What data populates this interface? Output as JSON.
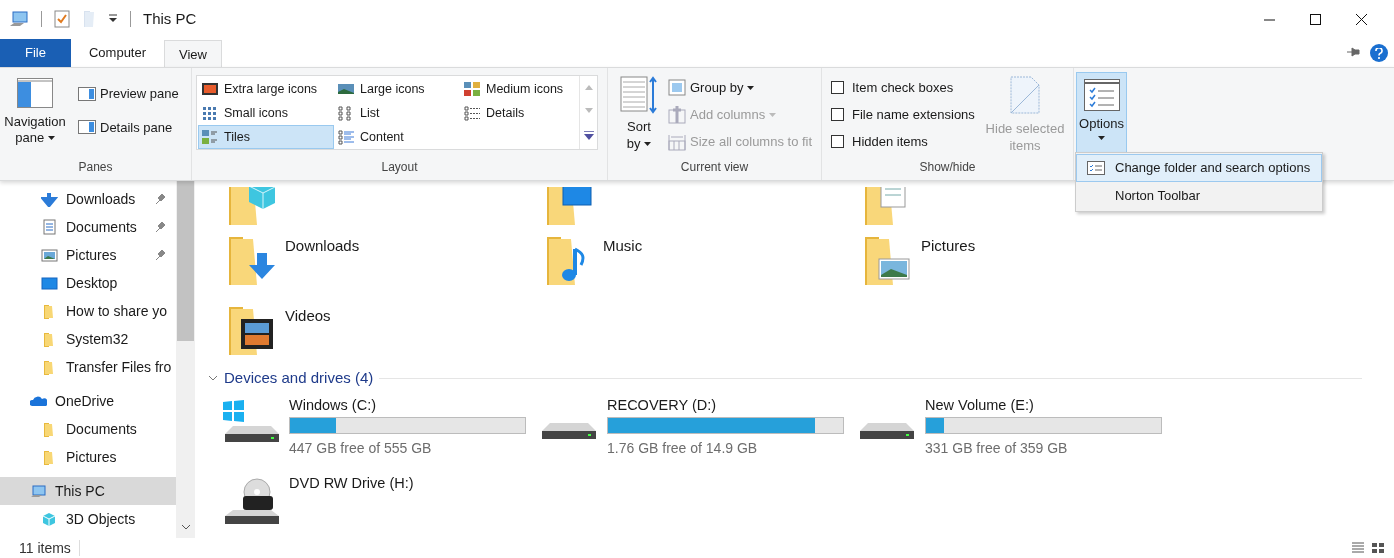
{
  "window": {
    "title": "This PC"
  },
  "tabs": [
    {
      "label": "File",
      "kind": "file",
      "selected": false
    },
    {
      "label": "Computer",
      "kind": "tab",
      "selected": false
    },
    {
      "label": "View",
      "kind": "tab",
      "selected": true
    }
  ],
  "ribbon": {
    "panes": {
      "label": "Panes",
      "navigation": "Navigation",
      "navigation_2": "pane",
      "items": [
        "Preview pane",
        "Details pane"
      ]
    },
    "layout": {
      "label": "Layout",
      "items": [
        {
          "label": "Extra large icons",
          "kind": "xl",
          "selected": false
        },
        {
          "label": "Large icons",
          "kind": "large",
          "selected": false
        },
        {
          "label": "Medium icons",
          "kind": "medium",
          "selected": false
        },
        {
          "label": "Small icons",
          "kind": "small",
          "selected": false
        },
        {
          "label": "List",
          "kind": "list",
          "selected": false
        },
        {
          "label": "Details",
          "kind": "details",
          "selected": false
        },
        {
          "label": "Tiles",
          "kind": "tiles",
          "selected": true
        },
        {
          "label": "Content",
          "kind": "content",
          "selected": false
        }
      ]
    },
    "current_view": {
      "label": "Current view",
      "sort": "Sort",
      "sort_2": "by",
      "items": [
        {
          "label": "Group by",
          "kind": "group",
          "disabled": false
        },
        {
          "label": "Add columns",
          "kind": "add",
          "disabled": true
        },
        {
          "label": "Size all columns to fit",
          "kind": "size",
          "disabled": true
        }
      ]
    },
    "show_hide": {
      "label": "Show/hide",
      "checkboxes": [
        {
          "label": "Item check boxes",
          "checked": false
        },
        {
          "label": "File name extensions",
          "checked": false
        },
        {
          "label": "Hidden items",
          "checked": false
        }
      ],
      "hide_selected": "Hide selected",
      "hide_selected_2": "items",
      "hide_disabled": true
    },
    "options": {
      "label": "Options",
      "selected": true
    }
  },
  "options_menu": [
    {
      "label": "Change folder and search options",
      "selected": true
    },
    {
      "label": "Norton Toolbar",
      "selected": false
    }
  ],
  "sidebar": {
    "items": [
      {
        "label": "Downloads",
        "kind": "downloads",
        "pinned": true,
        "selected": false
      },
      {
        "label": "Documents",
        "kind": "documents",
        "pinned": true,
        "selected": false
      },
      {
        "label": "Pictures",
        "kind": "pictures",
        "pinned": true,
        "selected": false
      },
      {
        "label": "Desktop",
        "kind": "desktop",
        "pinned": false,
        "selected": false
      },
      {
        "label": "How to share yo",
        "kind": "folder",
        "pinned": false,
        "selected": false
      },
      {
        "label": "System32",
        "kind": "folder",
        "pinned": false,
        "selected": false
      },
      {
        "label": "Transfer Files fro",
        "kind": "folder",
        "pinned": false,
        "selected": false
      },
      {
        "label": "OneDrive",
        "kind": "onedrive",
        "pinned": false,
        "selected": false
      },
      {
        "label": "Documents",
        "kind": "folder",
        "pinned": false,
        "selected": false
      },
      {
        "label": "Pictures",
        "kind": "folder",
        "pinned": false,
        "selected": false
      },
      {
        "label": "This PC",
        "kind": "pc",
        "pinned": false,
        "selected": true
      },
      {
        "label": "3D Objects",
        "kind": "cube",
        "pinned": false,
        "selected": false
      }
    ]
  },
  "folders": [
    {
      "kind": "cube"
    },
    {
      "kind": "desktop"
    },
    {
      "kind": "documents"
    },
    {
      "name": "Downloads",
      "kind": "downloads"
    },
    {
      "name": "Music",
      "kind": "music"
    },
    {
      "name": "Pictures",
      "kind": "pictures"
    },
    {
      "name": "Videos",
      "kind": "videos"
    }
  ],
  "drives_header": "Devices and drives (4)",
  "drives": [
    {
      "name": "Windows (C:)",
      "kind": "system",
      "level": 0.195,
      "free": "447 GB free of 555 GB"
    },
    {
      "name": "RECOVERY (D:)",
      "kind": "disk",
      "level": 0.88,
      "free": "1.76 GB free of 14.9 GB"
    },
    {
      "name": "New Volume (E:)",
      "kind": "disk",
      "level": 0.078,
      "free": "331 GB free of 359 GB"
    },
    {
      "name": "DVD RW Drive (H:)",
      "kind": "dvd"
    }
  ],
  "status_bar": {
    "count": "11 items"
  }
}
